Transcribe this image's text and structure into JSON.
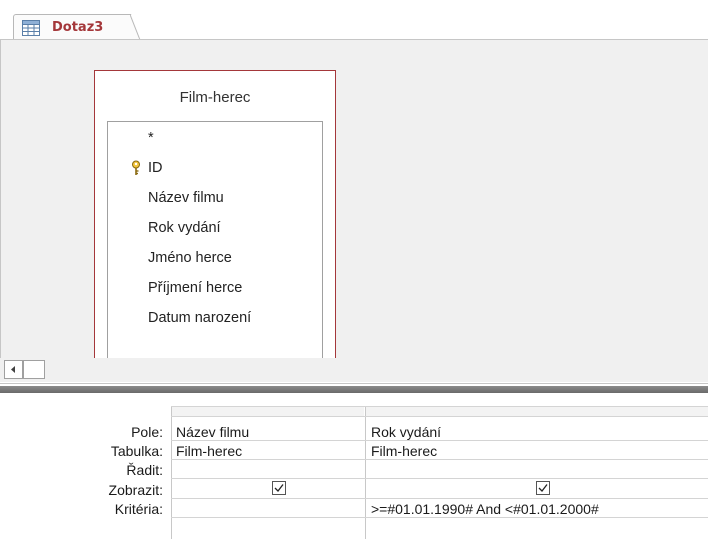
{
  "tab": {
    "title": "Dotaz3",
    "icon": "query-design-icon",
    "accent": "#a4373a"
  },
  "table": {
    "name": "Film-herec",
    "fields": [
      "*",
      "ID",
      "Název filmu",
      "Rok vydání",
      "Jméno herce",
      "Příjmení herce",
      "Datum narození"
    ],
    "primary_key_field": "ID",
    "border_color": "#a4373a"
  },
  "grid": {
    "row_labels": {
      "field": "Pole:",
      "table": "Tabulka:",
      "sort": "Řadit:",
      "show": "Zobrazit:",
      "criteria": "Kritéria:"
    },
    "columns": [
      {
        "field": "Název filmu",
        "table": "Film-herec",
        "sort": "",
        "show": true,
        "criteria": ""
      },
      {
        "field": "Rok vydání",
        "table": "Film-herec",
        "sort": "",
        "show": true,
        "criteria": ">=#01.01.1990# And <#01.01.2000#"
      }
    ]
  }
}
